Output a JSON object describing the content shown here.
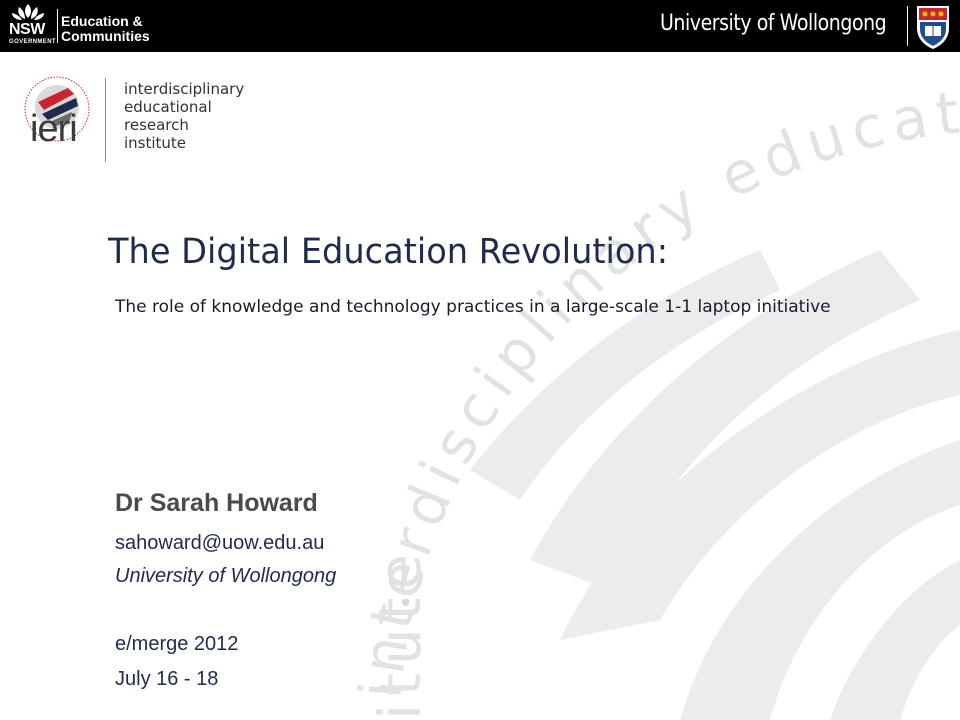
{
  "header": {
    "nsw_big": "NSW",
    "nsw_small": "GOVERNMENT",
    "dept_line1": "Education &",
    "dept_line2": "Communities",
    "university": "University of Wollongong"
  },
  "ieri": {
    "word": "ieri",
    "line1": "interdisciplinary",
    "line2": "educational",
    "line3": "research",
    "line4": "institute",
    "watermark_arc": "interdisciplinary educational res",
    "watermark_lower": "itute",
    "watermark_bullet": "•"
  },
  "slide": {
    "title": "The Digital Education Revolution:",
    "subtitle": "The role of knowledge and technology practices in a large-scale 1-1 laptop initiative",
    "author": "Dr Sarah Howard",
    "email": "sahoward@uow.edu.au",
    "affiliation": "University of Wollongong",
    "conference": "e/merge 2012",
    "dates": "July 16 - 18"
  },
  "colors": {
    "title": "#1f2a4d",
    "author": "#4a4a4a",
    "header_bg": "#000000",
    "logo_red": "#c8262e",
    "logo_navy": "#1f2a4d"
  }
}
